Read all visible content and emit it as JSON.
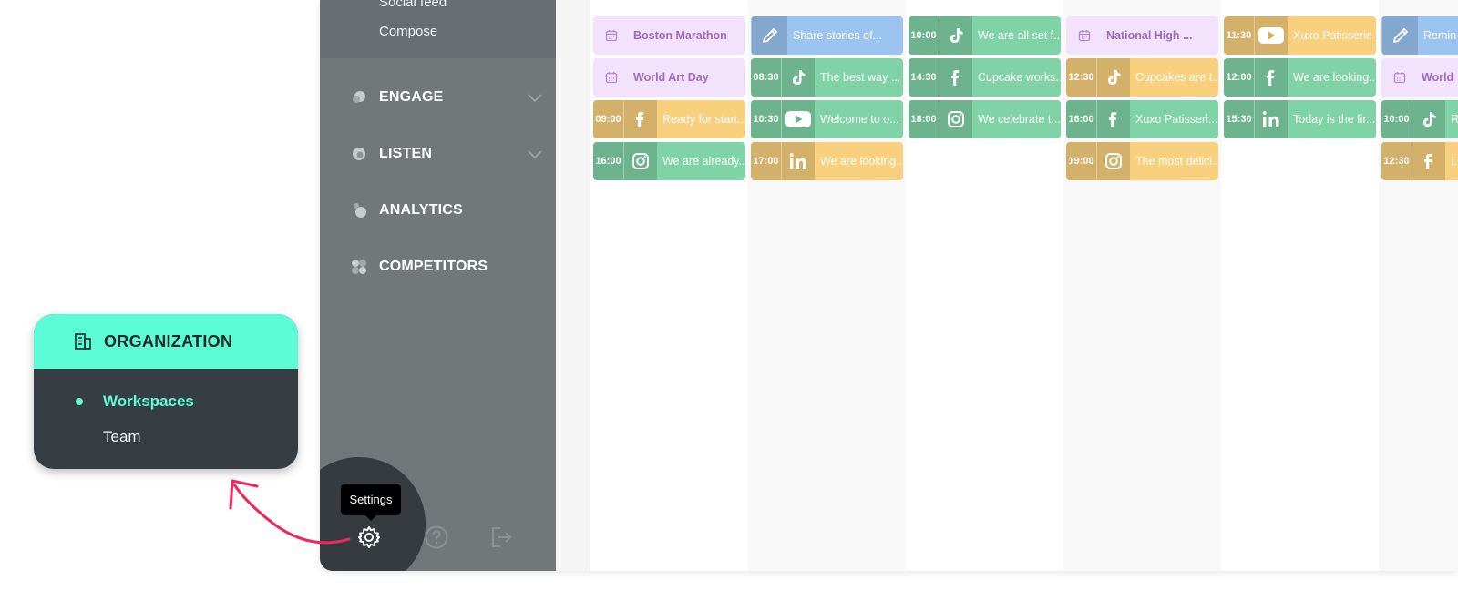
{
  "sidebar": {
    "sub_items": [
      "Social feed",
      "Compose"
    ],
    "nav": [
      {
        "key": "engage",
        "label": "ENGAGE",
        "icon": "engage-icon",
        "expandable": true
      },
      {
        "key": "listen",
        "label": "LISTEN",
        "icon": "listen-icon",
        "expandable": true
      },
      {
        "key": "analytics",
        "label": "ANALYTICS",
        "icon": "analytics-icon",
        "expandable": false
      },
      {
        "key": "competitors",
        "label": "COMPETITORS",
        "icon": "competitors-icon",
        "expandable": false
      }
    ],
    "bottom_icons": [
      "gear-icon",
      "help-icon",
      "logout-icon"
    ],
    "tooltip": "Settings"
  },
  "organization": {
    "title": "ORGANIZATION",
    "icon": "building-icon",
    "items": [
      {
        "label": "Workspaces",
        "active": true
      },
      {
        "label": "Team",
        "active": false
      }
    ]
  },
  "colors": {
    "accent": "#5cfcd5",
    "arrow": "#f0285a",
    "sidebar": "#72777a",
    "popover_bg": "#373e43",
    "event_bg": "#f3e2fb",
    "facebook": "#f8d07e",
    "tiktok": "#7fd3a7",
    "instagram": "#7fd3a7",
    "linkedin": "#f8d07e",
    "youtube": "#f8d07e",
    "note": "#9bc4f1"
  },
  "calendar": {
    "columns": [
      [
        {
          "type": "event",
          "text": "Boston Marathon"
        },
        {
          "type": "event",
          "text": "World Art Day"
        },
        {
          "type": "post",
          "time": "09:00",
          "network": "facebook",
          "color": "#f8d07e",
          "text": "Ready for start..."
        },
        {
          "type": "post",
          "time": "16:00",
          "network": "instagram",
          "color": "#7fd3a7",
          "text": "We are already..."
        }
      ],
      [
        {
          "type": "note",
          "network": "pencil",
          "color": "#9bc4f1",
          "text": "Share stories of..."
        },
        {
          "type": "post",
          "time": "08:30",
          "network": "tiktok",
          "color": "#7fd3a7",
          "text": "The best way ..."
        },
        {
          "type": "post",
          "time": "10:30",
          "network": "youtube",
          "color": "#7fd3a7",
          "text": "Welcome to o..."
        },
        {
          "type": "post",
          "time": "17:00",
          "network": "linkedin",
          "color": "#f8d07e",
          "text": "We are looking..."
        }
      ],
      [
        {
          "type": "post",
          "time": "10:00",
          "network": "tiktok",
          "color": "#7fd3a7",
          "text": "We are all set f..."
        },
        {
          "type": "post",
          "time": "14:30",
          "network": "facebook",
          "color": "#7fd3a7",
          "text": "Cupcake works..."
        },
        {
          "type": "post",
          "time": "18:00",
          "network": "instagram",
          "color": "#7fd3a7",
          "text": "We celebrate t..."
        }
      ],
      [
        {
          "type": "event",
          "text": "National High ..."
        },
        {
          "type": "post",
          "time": "12:30",
          "network": "tiktok",
          "color": "#f8d07e",
          "text": "Cupcakes are t..."
        },
        {
          "type": "post",
          "time": "16:00",
          "network": "facebook",
          "color": "#7fd3a7",
          "text": "Xuxo Patisseri..."
        },
        {
          "type": "post",
          "time": "19:00",
          "network": "instagram",
          "color": "#f8d07e",
          "text": "The most delici..."
        }
      ],
      [
        {
          "type": "post",
          "time": "11:30",
          "network": "youtube",
          "color": "#f8d07e",
          "text": "Xuxo Patisserie"
        },
        {
          "type": "post",
          "time": "12:00",
          "network": "facebook",
          "color": "#7fd3a7",
          "text": "We are looking..."
        },
        {
          "type": "post",
          "time": "15:30",
          "network": "linkedin",
          "color": "#7fd3a7",
          "text": "Today is the fir..."
        }
      ],
      [
        {
          "type": "note",
          "network": "pencil",
          "color": "#9bc4f1",
          "text": "Remin"
        },
        {
          "type": "event",
          "text": "World"
        },
        {
          "type": "post",
          "time": "10:00",
          "network": "tiktok",
          "color": "#7fd3a7",
          "text": "R"
        },
        {
          "type": "post",
          "time": "12:30",
          "network": "facebook",
          "color": "#f8d07e",
          "text": "L"
        }
      ]
    ]
  }
}
